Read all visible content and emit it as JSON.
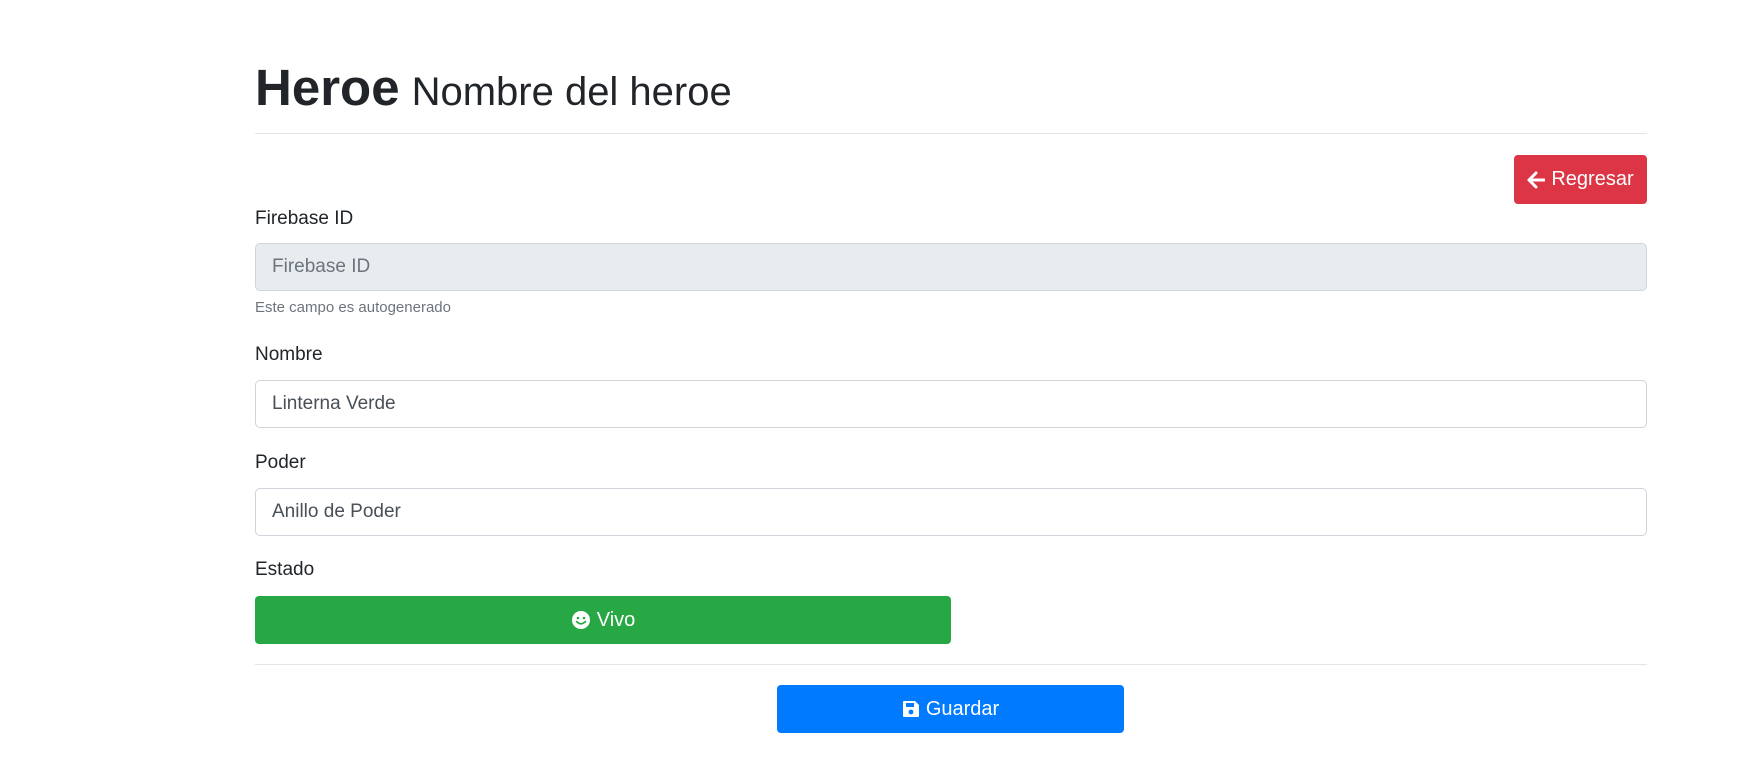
{
  "header": {
    "title": "Heroe",
    "subtitle": "Nombre del heroe"
  },
  "back_button": {
    "label": "Regresar",
    "icon": "arrow-left-icon"
  },
  "form": {
    "firebase_id": {
      "label": "Firebase ID",
      "placeholder": "Firebase ID",
      "value": "",
      "help": "Este campo es autogenerado",
      "disabled": true
    },
    "nombre": {
      "label": "Nombre",
      "value": "Linterna Verde"
    },
    "poder": {
      "label": "Poder",
      "value": "Anillo de Poder"
    },
    "estado": {
      "label": "Estado",
      "button_label": "Vivo",
      "icon": "smile-icon",
      "color": "#28a745"
    }
  },
  "save_button": {
    "label": "Guardar",
    "icon": "save-icon",
    "color": "#007bff"
  },
  "colors": {
    "danger": "#dc3545",
    "success": "#28a745",
    "primary": "#007bff"
  }
}
